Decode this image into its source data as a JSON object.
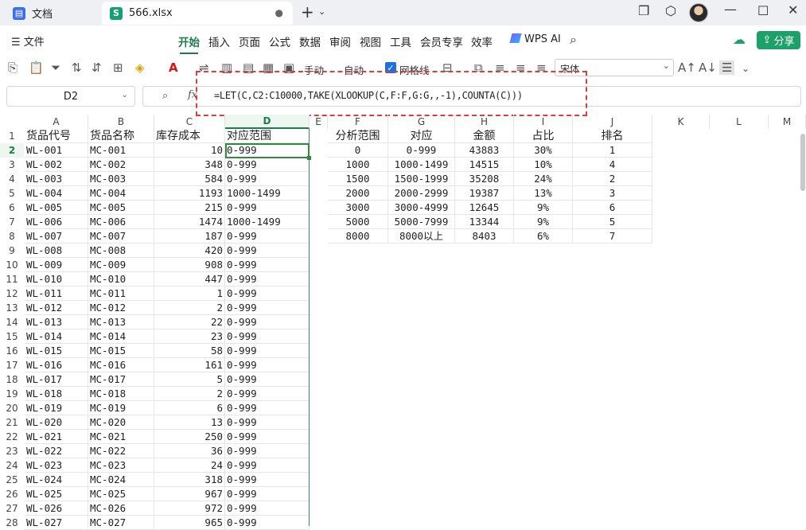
{
  "titlebar": {
    "tab_docs": "文档",
    "tab_file": "566.xlsx",
    "tab_file_icon": "S",
    "new_tab": "+"
  },
  "menu": {
    "file": "文件",
    "tabs": [
      "开始",
      "插入",
      "页面",
      "公式",
      "数据",
      "审阅",
      "视图",
      "工具",
      "会员专享",
      "效率"
    ],
    "wps_ai": "WPS AI",
    "share": "分享"
  },
  "toolbar": {
    "manual": "手动",
    "auto": "自动",
    "gridlines": "网格线",
    "font": "宋体"
  },
  "formula_bar": {
    "name_box": "D2",
    "formula": "=LET(C,C2:C10000,TAKE(XLOOKUP(C,F:F,G:G,,-1),COUNTA(C)))"
  },
  "columns": [
    "A",
    "B",
    "C",
    "D",
    "E",
    "F",
    "G",
    "H",
    "I",
    "J",
    "K",
    "L",
    "M"
  ],
  "header_row": {
    "A": "货品代号",
    "B": "货品名称",
    "C": "库存成本",
    "D": "对应范围",
    "F": "分析范围",
    "G": "对应",
    "H": "金额",
    "I": "占比",
    "J": "排名"
  },
  "main_rows": [
    [
      "WL-001",
      "MC-001",
      "10",
      "0-999"
    ],
    [
      "WL-002",
      "MC-002",
      "348",
      "0-999"
    ],
    [
      "WL-003",
      "MC-003",
      "584",
      "0-999"
    ],
    [
      "WL-004",
      "MC-004",
      "1193",
      "1000-1499"
    ],
    [
      "WL-005",
      "MC-005",
      "215",
      "0-999"
    ],
    [
      "WL-006",
      "MC-006",
      "1474",
      "1000-1499"
    ],
    [
      "WL-007",
      "MC-007",
      "187",
      "0-999"
    ],
    [
      "WL-008",
      "MC-008",
      "420",
      "0-999"
    ],
    [
      "WL-009",
      "MC-009",
      "908",
      "0-999"
    ],
    [
      "WL-010",
      "MC-010",
      "447",
      "0-999"
    ],
    [
      "WL-011",
      "MC-011",
      "1",
      "0-999"
    ],
    [
      "WL-012",
      "MC-012",
      "2",
      "0-999"
    ],
    [
      "WL-013",
      "MC-013",
      "22",
      "0-999"
    ],
    [
      "WL-014",
      "MC-014",
      "23",
      "0-999"
    ],
    [
      "WL-015",
      "MC-015",
      "58",
      "0-999"
    ],
    [
      "WL-016",
      "MC-016",
      "161",
      "0-999"
    ],
    [
      "WL-017",
      "MC-017",
      "5",
      "0-999"
    ],
    [
      "WL-018",
      "MC-018",
      "2",
      "0-999"
    ],
    [
      "WL-019",
      "MC-019",
      "6",
      "0-999"
    ],
    [
      "WL-020",
      "MC-020",
      "13",
      "0-999"
    ],
    [
      "WL-021",
      "MC-021",
      "250",
      "0-999"
    ],
    [
      "WL-022",
      "MC-022",
      "36",
      "0-999"
    ],
    [
      "WL-023",
      "MC-023",
      "24",
      "0-999"
    ],
    [
      "WL-024",
      "MC-024",
      "318",
      "0-999"
    ],
    [
      "WL-025",
      "MC-025",
      "967",
      "0-999"
    ],
    [
      "WL-026",
      "MC-026",
      "972",
      "0-999"
    ],
    [
      "WL-027",
      "MC-027",
      "965",
      "0-999"
    ]
  ],
  "analysis_rows": [
    [
      "0",
      "0-999",
      "43883",
      "30%",
      "1"
    ],
    [
      "1000",
      "1000-1499",
      "14515",
      "10%",
      "4"
    ],
    [
      "1500",
      "1500-1999",
      "35208",
      "24%",
      "2"
    ],
    [
      "2000",
      "2000-2999",
      "19387",
      "13%",
      "3"
    ],
    [
      "3000",
      "3000-4999",
      "12645",
      "9%",
      "6"
    ],
    [
      "5000",
      "5000-7999",
      "13344",
      "9%",
      "5"
    ],
    [
      "8000",
      "8000以上",
      "8403",
      "6%",
      "7"
    ]
  ],
  "colors": {
    "accent_green": "#1b7c4c",
    "share_button": "#1ea06a",
    "highlight_red": "#e23b3b"
  }
}
